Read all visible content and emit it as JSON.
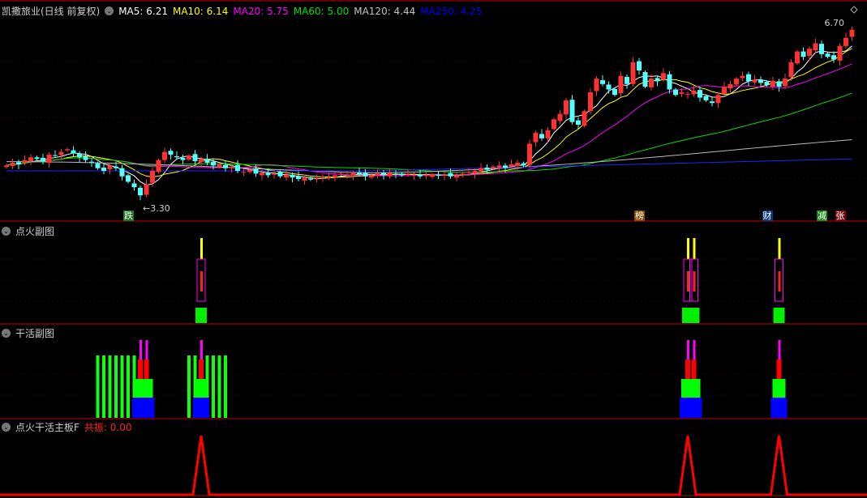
{
  "title": "凯撒旅业(日线 前复权)",
  "ma_legend": [
    {
      "label": "MA5: 6.21",
      "color": "#ffffff"
    },
    {
      "label": "MA10: 6.14",
      "color": "#ffff00"
    },
    {
      "label": "MA20: 5.75",
      "color": "#ff00ff"
    },
    {
      "label": "MA60: 5.00",
      "color": "#00e000"
    },
    {
      "label": "MA120: 4.44",
      "color": "#c0c0c0"
    },
    {
      "label": "MA250: 4.25",
      "color": "#0000ff"
    }
  ],
  "price_high_label": "6.70",
  "price_low_label": "3.30",
  "event_tags": [
    {
      "text": "跌",
      "index": 20,
      "color": "#1a7a1a"
    },
    {
      "text": "榜",
      "index": 104,
      "color": "#8a4a00"
    },
    {
      "text": "财",
      "index": 125,
      "color": "#0a3a7a"
    },
    {
      "text": "减",
      "index": 134,
      "color": "#1a8a1a"
    },
    {
      "text": "张",
      "index": 137,
      "color": "#7a0a0a"
    }
  ],
  "panels": {
    "dianhuo": "点火副图",
    "ganhuo": "干活副图",
    "main_f": "点火干活主板F",
    "gongzhen_label": "共振",
    "gongzhen_value": "0.00"
  },
  "chart_data": {
    "type": "candlestick",
    "ylim": [
      3.3,
      6.7
    ],
    "closes": [
      4.1,
      4.15,
      4.12,
      4.2,
      4.25,
      4.22,
      4.18,
      4.3,
      4.28,
      4.35,
      4.4,
      4.32,
      4.25,
      4.2,
      4.15,
      4.05,
      4.0,
      4.1,
      4.05,
      3.9,
      3.8,
      3.7,
      3.55,
      3.75,
      4.0,
      4.2,
      4.35,
      4.3,
      4.25,
      4.2,
      4.28,
      4.18,
      4.22,
      4.15,
      4.1,
      4.12,
      4.05,
      4.08,
      4.0,
      3.98,
      4.02,
      3.95,
      3.97,
      3.92,
      3.95,
      3.9,
      3.93,
      3.88,
      3.85,
      3.87,
      3.84,
      3.86,
      3.9,
      3.88,
      3.92,
      3.95,
      3.93,
      3.96,
      3.94,
      3.9,
      3.92,
      3.95,
      3.93,
      3.96,
      3.94,
      3.92,
      3.95,
      3.93,
      3.9,
      3.92,
      3.94,
      3.91,
      3.93,
      3.9,
      3.92,
      3.95,
      3.98,
      4.0,
      4.05,
      4.02,
      4.08,
      4.1,
      4.06,
      4.12,
      4.15,
      4.1,
      4.5,
      4.7,
      4.6,
      4.75,
      4.95,
      5.05,
      5.3,
      4.9,
      4.85,
      5.1,
      5.45,
      5.7,
      5.6,
      5.5,
      5.4,
      5.75,
      5.6,
      6.0,
      5.85,
      5.55,
      5.7,
      5.65,
      5.8,
      5.5,
      5.4,
      5.45,
      5.42,
      5.48,
      5.35,
      5.3,
      5.25,
      5.4,
      5.55,
      5.6,
      5.7,
      5.75,
      5.65,
      5.68,
      5.62,
      5.58,
      5.66,
      5.55,
      5.7,
      6.0,
      6.2,
      6.1,
      6.25,
      6.35,
      6.15,
      6.1,
      6.05,
      6.3,
      6.45,
      6.6
    ],
    "dianhuo_signals": [
      32,
      112,
      113,
      127
    ],
    "ganhuo_green_bars": [
      15,
      16,
      17,
      18,
      19,
      20,
      21,
      30,
      31,
      33,
      34,
      35,
      36
    ],
    "ganhuo_blocks": [
      22,
      23,
      32,
      112,
      113,
      127
    ],
    "gongzhen_peaks": [
      32,
      112,
      127
    ]
  }
}
